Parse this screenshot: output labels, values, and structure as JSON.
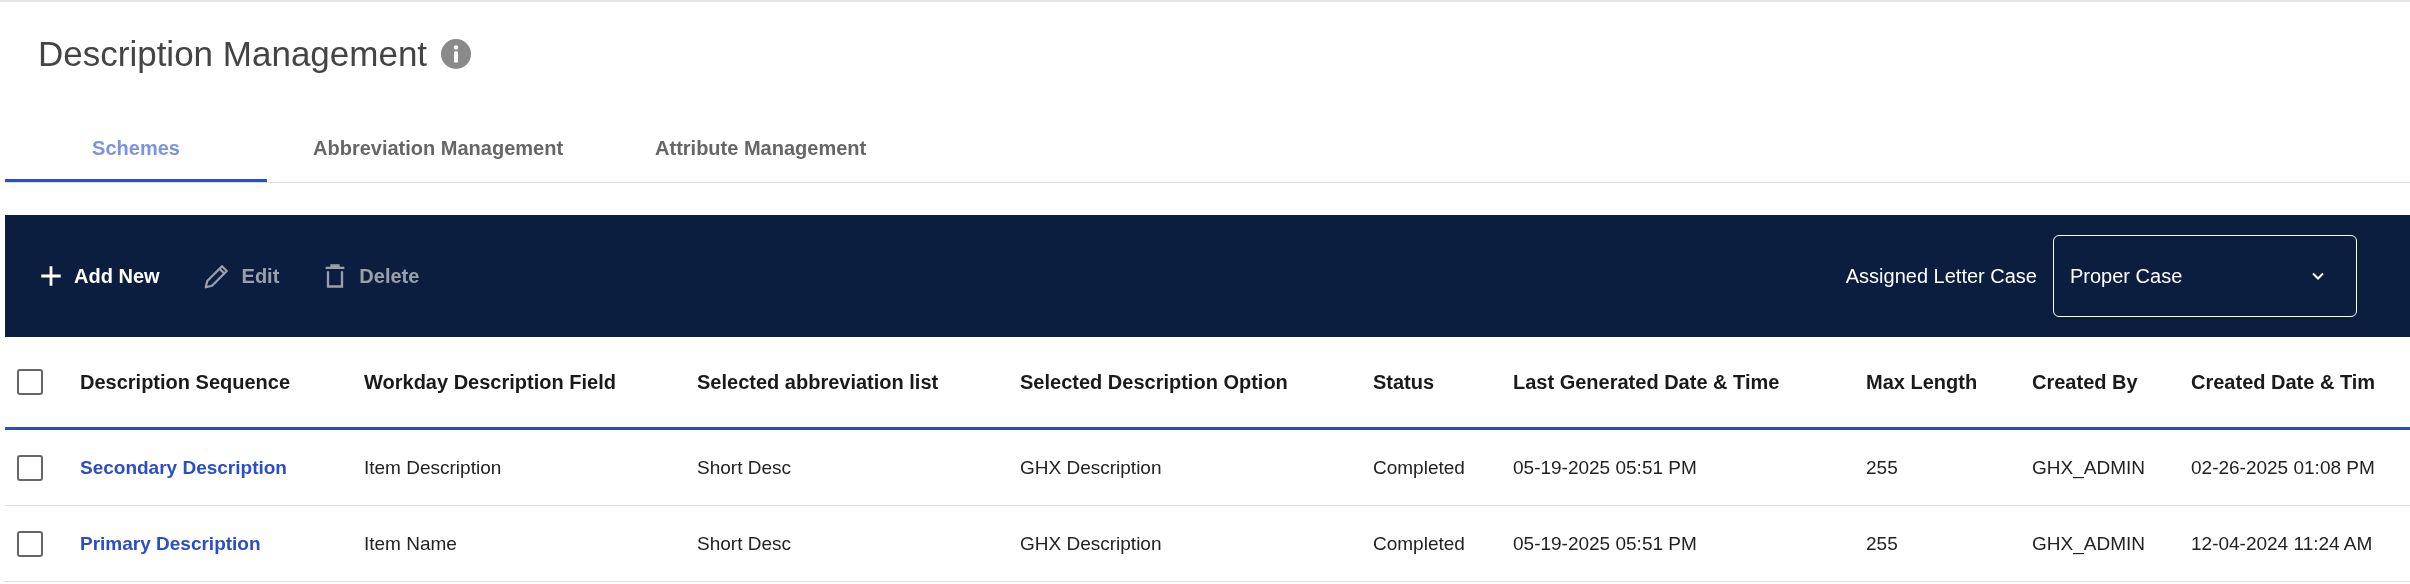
{
  "page": {
    "title": "Description Management"
  },
  "tabs": [
    {
      "label": "Schemes",
      "selected": true
    },
    {
      "label": "Abbreviation Management",
      "selected": false
    },
    {
      "label": "Attribute Management",
      "selected": false
    }
  ],
  "toolbar": {
    "actions": [
      {
        "kind": "add",
        "label": "Add New",
        "disabled": false
      },
      {
        "kind": "edit",
        "label": "Edit",
        "disabled": true
      },
      {
        "kind": "delete",
        "label": "Delete",
        "disabled": true
      }
    ],
    "letter_case": {
      "label": "Assigned Letter Case",
      "value": "Proper Case"
    }
  },
  "table": {
    "select_all": {
      "checked": false
    },
    "columns": [
      "Description Sequence",
      "Workday Description Field",
      "Selected abbreviation list",
      "Selected Description Option",
      "Status",
      "Last Generated Date & Time",
      "Max Length",
      "Created By",
      "Created Date & Tim"
    ],
    "rows": [
      {
        "checked": false,
        "cells": [
          "Secondary Description",
          "Item Description",
          "Short Desc",
          "GHX Description",
          "Completed",
          "05-19-2025 05:51 PM",
          "255",
          "GHX_ADMIN",
          "02-26-2025 01:08 PM"
        ]
      },
      {
        "checked": false,
        "cells": [
          "Primary Description",
          "Item Name",
          "Short Desc",
          "GHX Description",
          "Completed",
          "05-19-2025 05:51 PM",
          "255",
          "GHX_ADMIN",
          "12-04-2024 11:24 AM"
        ]
      }
    ]
  }
}
